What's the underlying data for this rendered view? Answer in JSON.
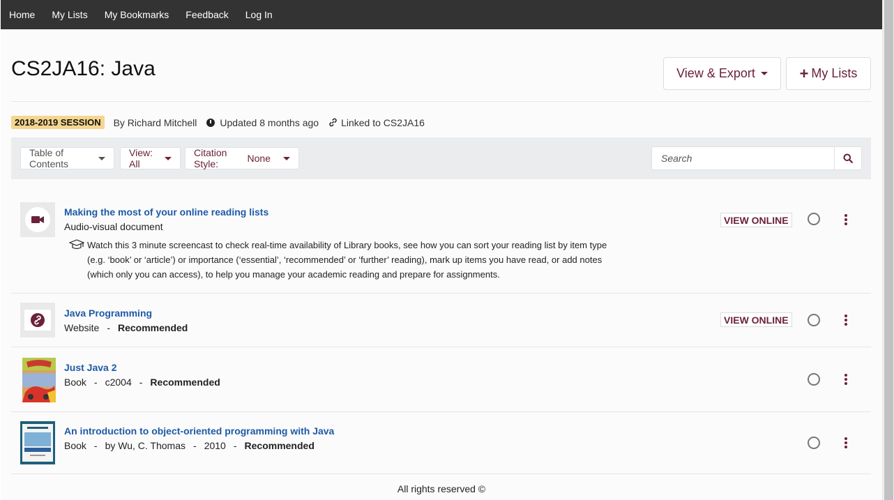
{
  "nav": {
    "items": [
      "Home",
      "My Lists",
      "My Bookmarks",
      "Feedback",
      "Log In"
    ]
  },
  "header": {
    "title": "CS2JA16: Java",
    "view_export": "View & Export",
    "my_lists": "My Lists"
  },
  "meta": {
    "session": "2018-2019 SESSION",
    "author": "By Richard Mitchell",
    "updated": "Updated 8 months ago",
    "linked": "Linked to CS2JA16"
  },
  "toolbar": {
    "toc": "Table of Contents",
    "view": "View: All",
    "citation_label": "Citation Style:",
    "citation_value": "None",
    "search_placeholder": "Search"
  },
  "items": [
    {
      "title": "Making the most of your online reading lists",
      "type": "Audio-visual document",
      "note": "Watch this 3 minute screencast to check real-time availability of Library books, see how you can sort your reading list by item type (e.g. ‘book’ or ‘article’) or importance (‘essential’, ‘recommended’ or ‘further’ reading), mark up items you have read, or add notes (which only you can access), to help you manage your academic reading and prepare for assignments.",
      "action": "VIEW ONLINE",
      "icon": "video-camera-icon"
    },
    {
      "title": "Java Programming",
      "type": "Website",
      "importance": "Recommended",
      "action": "VIEW ONLINE",
      "icon": "link-icon"
    },
    {
      "title": "Just Java 2",
      "type": "Book",
      "date": "c2004",
      "importance": "Recommended"
    },
    {
      "title": "An introduction to object-oriented programming with Java",
      "type": "Book",
      "author": "by Wu, C. Thomas",
      "date": "2010",
      "importance": "Recommended"
    }
  ],
  "separator": "-",
  "footer": "All rights reserved ©",
  "colors": {
    "nav_bg": "#333333",
    "accent": "#6b2239",
    "link": "#1e5aa8",
    "badge": "#f5d58f",
    "toolbar_bg": "#eaecee"
  }
}
